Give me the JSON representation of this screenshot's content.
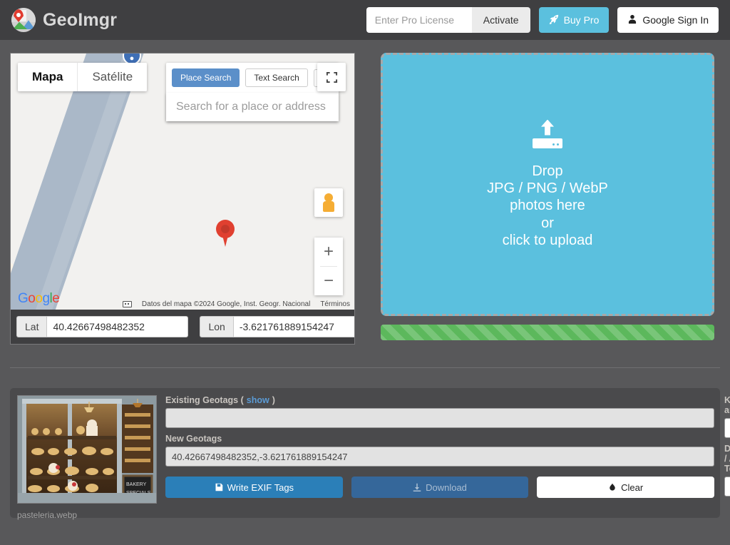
{
  "app": {
    "name": "GeoImgr",
    "logo_icon": "map-pin-logo-icon"
  },
  "header": {
    "license_placeholder": "Enter Pro License",
    "license_value": "",
    "activate_label": "Activate",
    "buy_label": "Buy Pro",
    "buy_icon": "rocket-icon",
    "buy_color": "#5bc0de",
    "signin_label": "Google Sign In",
    "signin_icon": "person-icon"
  },
  "map": {
    "types": [
      {
        "label": "Mapa",
        "active": true
      },
      {
        "label": "Satélite",
        "active": false
      }
    ],
    "search_modes": [
      {
        "label": "Place Search",
        "active": true
      },
      {
        "label": "Text Search",
        "active": false
      }
    ],
    "search_caret_icon": "chevron-down-icon",
    "search_placeholder": "Search for a place or address",
    "search_value": "",
    "fullscreen_icon": "fullscreen-icon",
    "pegman_icon": "street-view-pegman-icon",
    "zoom_in_label": "+",
    "zoom_out_label": "−",
    "provider_logo": "Google",
    "keyboard_icon": "keyboard-shortcuts-icon",
    "attribution": "Datos del mapa ©2024 Google, Inst. Geogr. Nacional",
    "terms_label": "Términos",
    "marker_icon": "map-marker-icon",
    "lat_label": "Lat",
    "lat_value": "40.42667498482352",
    "lon_label": "Lon",
    "lon_value": "-3.621761889154247"
  },
  "dropzone": {
    "icon": "cloud-upload-icon",
    "line1": "Drop",
    "line2": "JPG / PNG / WebP",
    "line3": "photos here",
    "line4": "or",
    "line5": "click to upload",
    "background": "#5bc0de",
    "progress_percent": 100,
    "progress_color": "#5cb85c"
  },
  "photo": {
    "filename": "pasteleria.webp",
    "thumbnail_alt": "bakery-shop-window-photo",
    "existing_geotags_label": "Existing Geotags (",
    "existing_geotags_link": "show",
    "existing_geotags_label_end": ")",
    "existing_geotags_value": "",
    "new_geotags_label": "New Geotags",
    "new_geotags_value": "40.42667498482352,-3.621761889154247",
    "keywords_label": "Keywords and Tags",
    "keywords_value": "",
    "description_label": "Description / Alternative Text",
    "description_value": "",
    "help_icon": "help-circle-icon",
    "buttons": [
      {
        "label": "Write EXIF Tags",
        "icon": "save-icon",
        "style": "primary"
      },
      {
        "label": "Download",
        "icon": "download-icon",
        "style": "muted"
      },
      {
        "label": "Clear",
        "icon": "eraser-icon",
        "style": "light"
      }
    ]
  }
}
